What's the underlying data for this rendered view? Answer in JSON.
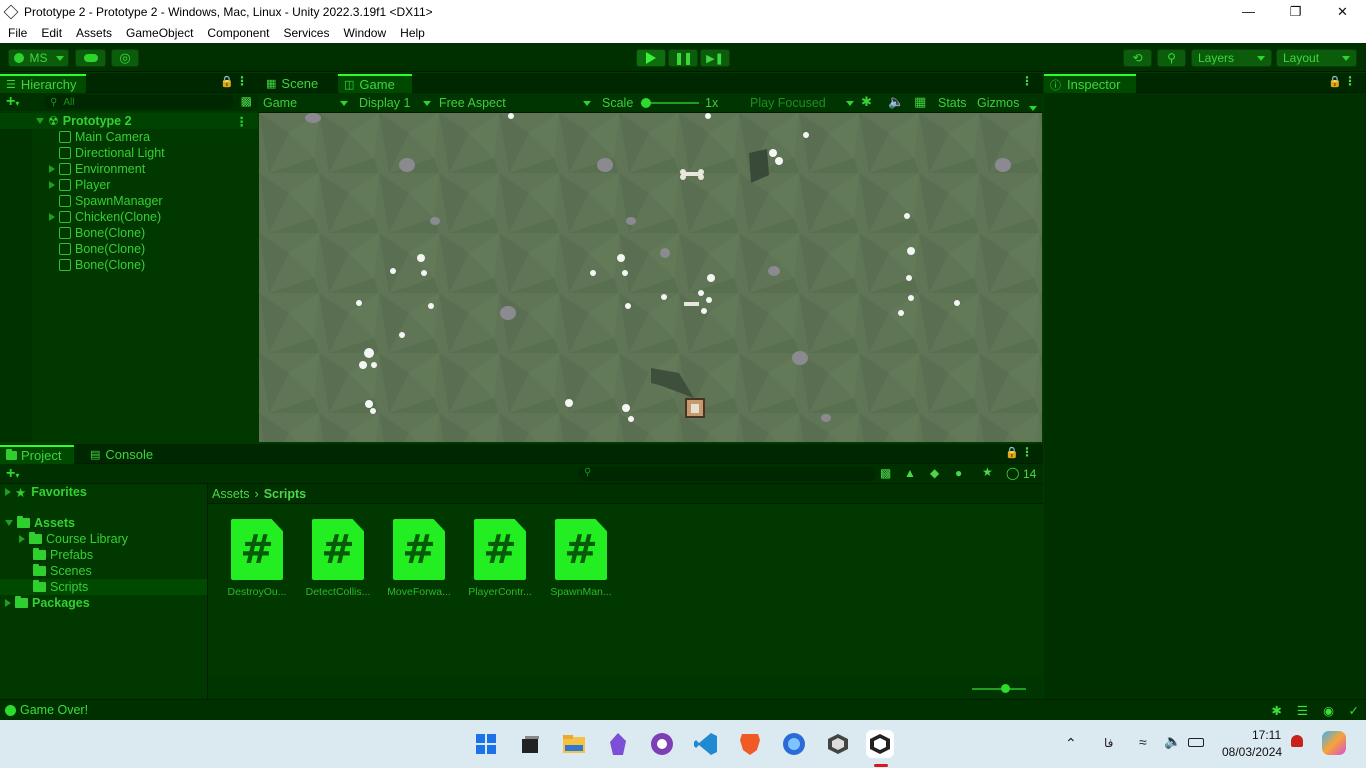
{
  "window": {
    "title": "Prototype 2 - Prototype 2 - Windows, Mac, Linux - Unity 2022.3.19f1 <DX11>"
  },
  "menu": [
    "File",
    "Edit",
    "Assets",
    "GameObject",
    "Component",
    "Services",
    "Window",
    "Help"
  ],
  "toolbar": {
    "account": "MS",
    "layers": "Layers",
    "layout": "Layout"
  },
  "hierarchy": {
    "tab": "Hierarchy",
    "search_placeholder": "All",
    "scene": "Prototype 2",
    "items": [
      {
        "label": "Main Camera",
        "expandable": false
      },
      {
        "label": "Directional Light",
        "expandable": false
      },
      {
        "label": "Environment",
        "expandable": true
      },
      {
        "label": "Player",
        "expandable": true
      },
      {
        "label": "SpawnManager",
        "expandable": false
      },
      {
        "label": "Chicken(Clone)",
        "expandable": true
      },
      {
        "label": "Bone(Clone)",
        "expandable": false
      },
      {
        "label": "Bone(Clone)",
        "expandable": false
      },
      {
        "label": "Bone(Clone)",
        "expandable": false
      }
    ]
  },
  "viewtabs": {
    "scene": "Scene",
    "game": "Game"
  },
  "gametoolbar": {
    "display_mode": "Game",
    "display": "Display 1",
    "aspect": "Free Aspect",
    "scale_label": "Scale",
    "scale_value": "1x",
    "play_focused": "Play Focused",
    "stats": "Stats",
    "gizmos": "Gizmos"
  },
  "inspector": {
    "tab": "Inspector"
  },
  "project": {
    "tab": "Project",
    "console_tab": "Console",
    "hidden_count": "14",
    "favorites": "Favorites",
    "assets": "Assets",
    "folders": [
      "Course Library",
      "Prefabs",
      "Scenes",
      "Scripts"
    ],
    "packages": "Packages",
    "breadcrumb": [
      "Assets",
      "Scripts"
    ],
    "scripts": [
      "DestroyOu...",
      "DetectCollis...",
      "MoveForwa...",
      "PlayerContr...",
      "SpawnMan..."
    ]
  },
  "status": {
    "message": "Game Over!"
  },
  "taskbar": {
    "time": "17:11",
    "date": "08/03/2024",
    "lang": "فا"
  },
  "colors": {
    "accent": "#2aff2a",
    "panel": "#003800",
    "game_ground": "#5e7456"
  }
}
